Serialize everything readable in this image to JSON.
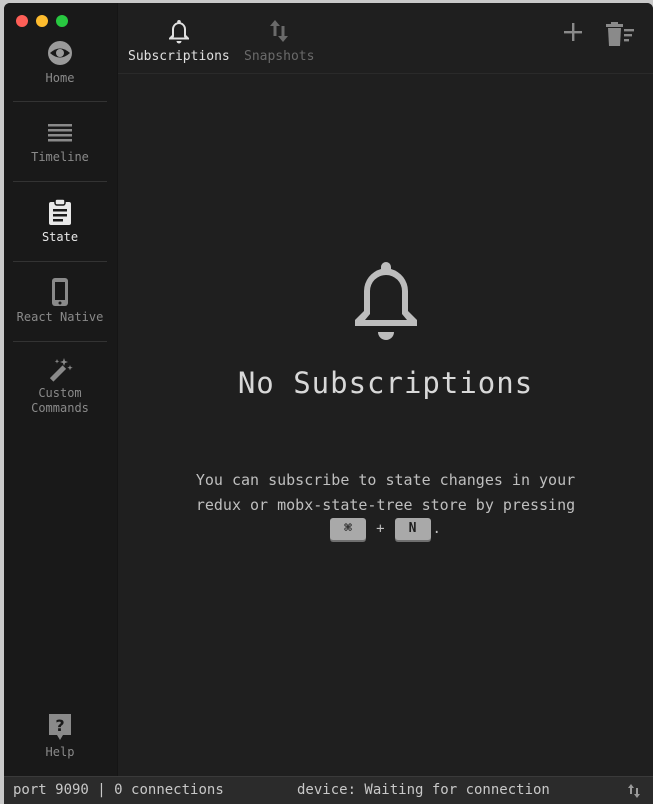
{
  "sidebar": {
    "items": [
      {
        "label": "Home",
        "icon": "home-eye-icon"
      },
      {
        "label": "Timeline",
        "icon": "list-icon"
      },
      {
        "label": "State",
        "icon": "clipboard-icon"
      },
      {
        "label": "React Native",
        "icon": "phone-icon"
      },
      {
        "label": "Custom Commands",
        "icon": "magic-wand-icon"
      },
      {
        "label": "Help",
        "icon": "help-icon"
      }
    ],
    "active": "State"
  },
  "tabs": [
    {
      "label": "Subscriptions",
      "icon": "bell-icon",
      "active": true
    },
    {
      "label": "Snapshots",
      "icon": "sort-arrows-icon",
      "active": false
    }
  ],
  "toolbar": {
    "add_icon": "plus-icon",
    "clear_icon": "trash-list-icon"
  },
  "empty_state": {
    "title": "No Subscriptions",
    "text": "You can subscribe to state changes in your redux or mobx-state-tree store by pressing",
    "key1": "⌘",
    "plus": "+",
    "key2": "N",
    "period": "."
  },
  "status": {
    "port": "port 9090",
    "divider": "|",
    "connections": "0 connections",
    "device": "device: Waiting for connection"
  },
  "colors": {
    "background": "#1f1f1f",
    "sidebar": "#191919",
    "statusbar": "#2b2b2b",
    "key": "#a9a9a9"
  }
}
